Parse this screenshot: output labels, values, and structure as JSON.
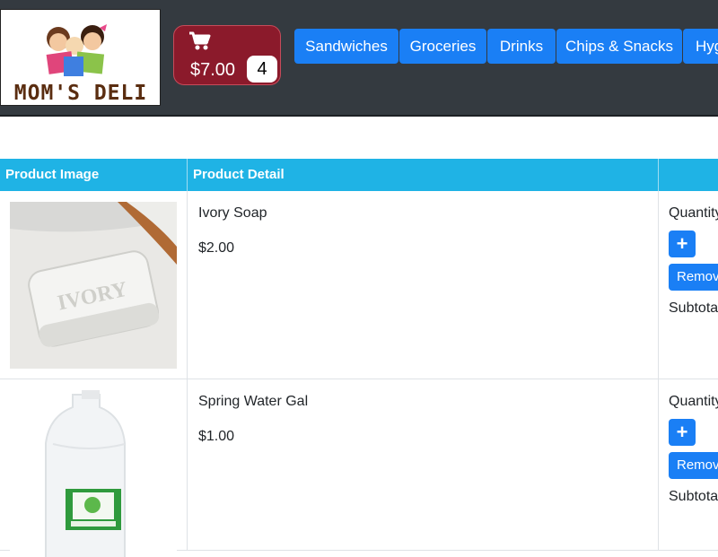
{
  "brand": {
    "logo_text": "MOM'S DELI"
  },
  "cart": {
    "total": "$7.00",
    "count": "4"
  },
  "nav": [
    {
      "label": "Sandwiches"
    },
    {
      "label": "Groceries"
    },
    {
      "label": "Drinks"
    },
    {
      "label": "Chips & Snacks"
    },
    {
      "label": "Hyg"
    }
  ],
  "table": {
    "columns": [
      "Product Image",
      "Product Detail",
      ""
    ],
    "rows": [
      {
        "name": "Ivory Soap",
        "price": "$2.00",
        "quantity_label": "Quantity",
        "plus_label": "+",
        "remove_label": "Remove",
        "subtotal_label": "Subtotal"
      },
      {
        "name": "Spring Water Gal",
        "price": "$1.00",
        "quantity_label": "Quantity",
        "plus_label": "+",
        "remove_label": "Remove",
        "subtotal_label": "Subtotal"
      }
    ]
  },
  "colors": {
    "topbar": "#343a40",
    "cart_bg": "#8b1a2b",
    "nav_button": "#1a7ff5",
    "table_header": "#1fb3e5"
  },
  "icons": {
    "cart": "shopping-cart-icon"
  }
}
